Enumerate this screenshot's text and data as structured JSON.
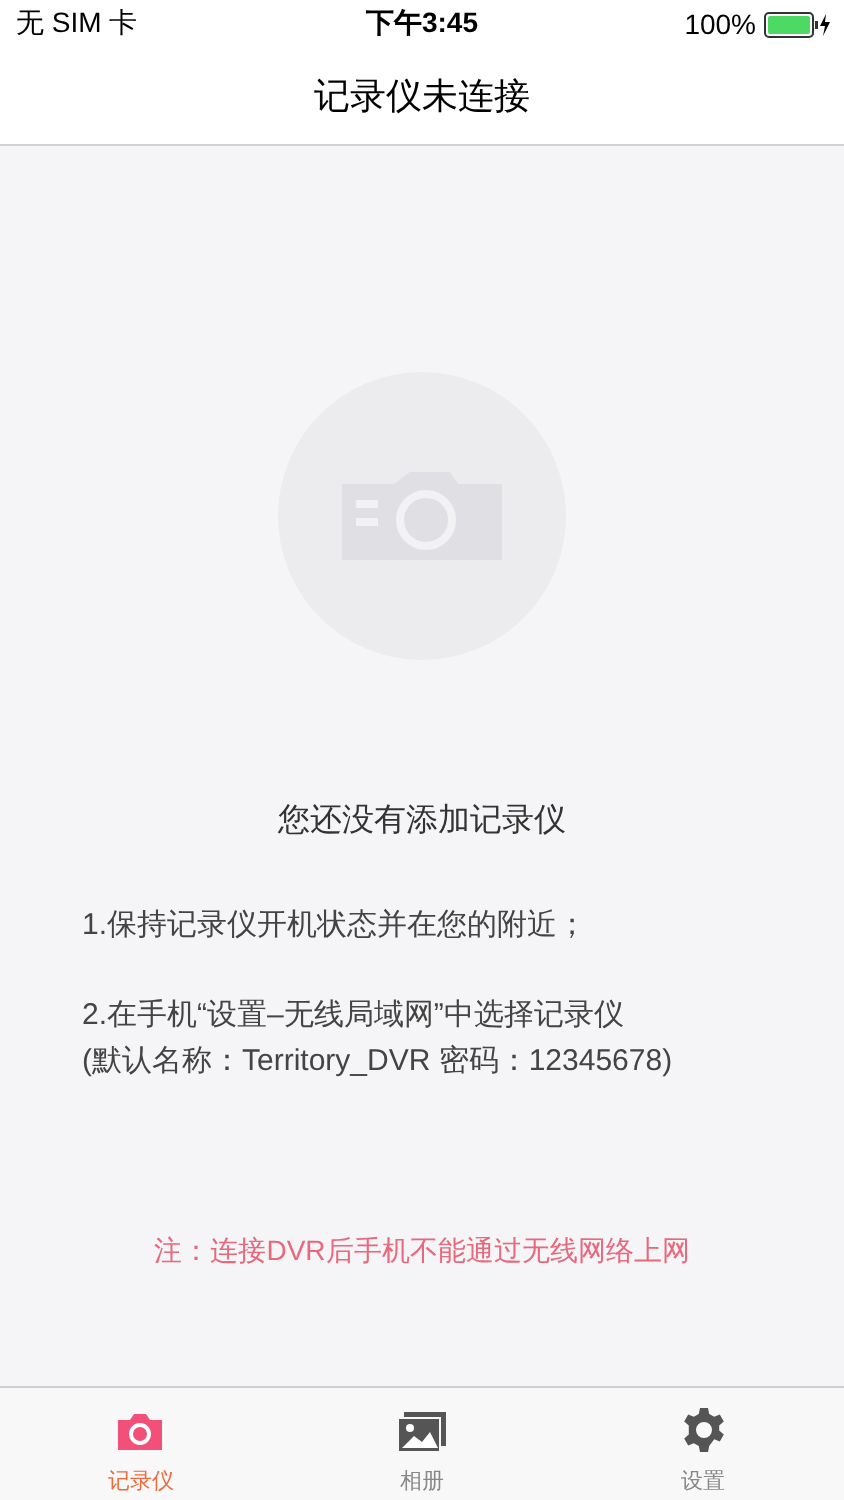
{
  "status_bar": {
    "carrier": "无 SIM 卡",
    "time": "下午3:45",
    "battery": "100%"
  },
  "nav": {
    "title": "记录仪未连接"
  },
  "empty": {
    "message": "您还没有添加记录仪",
    "steps": [
      "1.保持记录仪开机状态并在您的附近；",
      "2.在手机“设置–无线局域网”中选择记录仪\n(默认名称：Territory_DVR 密码：12345678)"
    ],
    "note": "注：连接DVR后手机不能通过无线网络上网"
  },
  "tabs": [
    {
      "kind": "camera",
      "label": "记录仪",
      "selected": true
    },
    {
      "kind": "album",
      "label": "相册",
      "selected": false
    },
    {
      "kind": "gear",
      "label": "设置",
      "selected": false
    }
  ]
}
